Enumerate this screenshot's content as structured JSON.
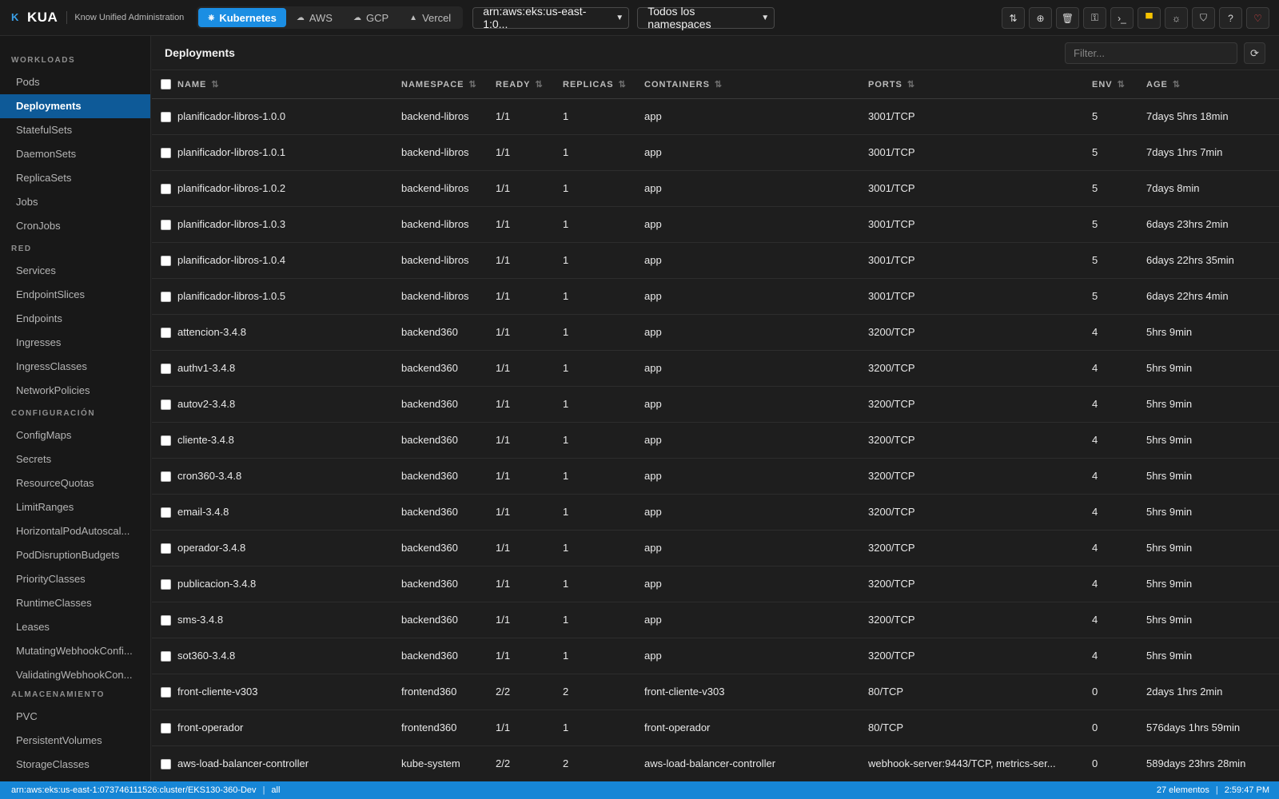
{
  "app": {
    "logo_glyph": "K",
    "name": "KUA",
    "subtitle": "Know Unified Administration"
  },
  "providers": [
    {
      "label": "Kubernetes",
      "icon": "kubernetes-icon",
      "active": true
    },
    {
      "label": "AWS",
      "icon": "cloud-icon",
      "active": false
    },
    {
      "label": "GCP",
      "icon": "cloud-icon",
      "active": false
    },
    {
      "label": "Vercel",
      "icon": "triangle-icon",
      "active": false
    }
  ],
  "cluster_select": {
    "value": "arn:aws:eks:us-east-1:0..."
  },
  "namespace_select": {
    "value": "Todos los namespaces"
  },
  "toolbar_icons": [
    "switch-icon",
    "add-circle-icon",
    "trash-icon",
    "key-icon",
    "terminal-icon",
    "spain-flag-icon",
    "sun-icon",
    "shield-icon",
    "help-icon",
    "heart-icon"
  ],
  "sidebar": {
    "sections": [
      {
        "title": "WORKLOADS",
        "items": [
          "Pods",
          "Deployments",
          "StatefulSets",
          "DaemonSets",
          "ReplicaSets",
          "Jobs",
          "CronJobs"
        ]
      },
      {
        "title": "RED",
        "items": [
          "Services",
          "EndpointSlices",
          "Endpoints",
          "Ingresses",
          "IngressClasses",
          "NetworkPolicies"
        ]
      },
      {
        "title": "CONFIGURACIÓN",
        "items": [
          "ConfigMaps",
          "Secrets",
          "ResourceQuotas",
          "LimitRanges",
          "HorizontalPodAutoscal...",
          "PodDisruptionBudgets",
          "PriorityClasses",
          "RuntimeClasses",
          "Leases",
          "MutatingWebhookConfi...",
          "ValidatingWebhookCon..."
        ]
      },
      {
        "title": "ALMACENAMIENTO",
        "items": [
          "PVC",
          "PersistentVolumes",
          "StorageClasses"
        ]
      }
    ],
    "active_item": "Deployments"
  },
  "main": {
    "title": "Deployments",
    "filter_placeholder": "Filter...",
    "columns": [
      "NAME",
      "NAMESPACE",
      "READY",
      "REPLICAS",
      "CONTAINERS",
      "PORTS",
      "ENV",
      "AGE"
    ],
    "rows": [
      [
        "planificador-libros-1.0.0",
        "backend-libros",
        "1/1",
        "1",
        "app",
        "3001/TCP",
        "5",
        "7days 5hrs 18min"
      ],
      [
        "planificador-libros-1.0.1",
        "backend-libros",
        "1/1",
        "1",
        "app",
        "3001/TCP",
        "5",
        "7days 1hrs 7min"
      ],
      [
        "planificador-libros-1.0.2",
        "backend-libros",
        "1/1",
        "1",
        "app",
        "3001/TCP",
        "5",
        "7days 8min"
      ],
      [
        "planificador-libros-1.0.3",
        "backend-libros",
        "1/1",
        "1",
        "app",
        "3001/TCP",
        "5",
        "6days 23hrs 2min"
      ],
      [
        "planificador-libros-1.0.4",
        "backend-libros",
        "1/1",
        "1",
        "app",
        "3001/TCP",
        "5",
        "6days 22hrs 35min"
      ],
      [
        "planificador-libros-1.0.5",
        "backend-libros",
        "1/1",
        "1",
        "app",
        "3001/TCP",
        "5",
        "6days 22hrs 4min"
      ],
      [
        "attencion-3.4.8",
        "backend360",
        "1/1",
        "1",
        "app",
        "3200/TCP",
        "4",
        "5hrs 9min"
      ],
      [
        "authv1-3.4.8",
        "backend360",
        "1/1",
        "1",
        "app",
        "3200/TCP",
        "4",
        "5hrs 9min"
      ],
      [
        "autov2-3.4.8",
        "backend360",
        "1/1",
        "1",
        "app",
        "3200/TCP",
        "4",
        "5hrs 9min"
      ],
      [
        "cliente-3.4.8",
        "backend360",
        "1/1",
        "1",
        "app",
        "3200/TCP",
        "4",
        "5hrs 9min"
      ],
      [
        "cron360-3.4.8",
        "backend360",
        "1/1",
        "1",
        "app",
        "3200/TCP",
        "4",
        "5hrs 9min"
      ],
      [
        "email-3.4.8",
        "backend360",
        "1/1",
        "1",
        "app",
        "3200/TCP",
        "4",
        "5hrs 9min"
      ],
      [
        "operador-3.4.8",
        "backend360",
        "1/1",
        "1",
        "app",
        "3200/TCP",
        "4",
        "5hrs 9min"
      ],
      [
        "publicacion-3.4.8",
        "backend360",
        "1/1",
        "1",
        "app",
        "3200/TCP",
        "4",
        "5hrs 9min"
      ],
      [
        "sms-3.4.8",
        "backend360",
        "1/1",
        "1",
        "app",
        "3200/TCP",
        "4",
        "5hrs 9min"
      ],
      [
        "sot360-3.4.8",
        "backend360",
        "1/1",
        "1",
        "app",
        "3200/TCP",
        "4",
        "5hrs 9min"
      ],
      [
        "front-cliente-v303",
        "frontend360",
        "2/2",
        "2",
        "front-cliente-v303",
        "80/TCP",
        "0",
        "2days 1hrs 2min"
      ],
      [
        "front-operador",
        "frontend360",
        "1/1",
        "1",
        "front-operador",
        "80/TCP",
        "0",
        "576days 1hrs 59min"
      ],
      [
        "aws-load-balancer-controller",
        "kube-system",
        "2/2",
        "2",
        "aws-load-balancer-controller",
        "webhook-server:9443/TCP, metrics-ser...",
        "0",
        "589days 23hrs 28min"
      ]
    ]
  },
  "statusbar": {
    "cluster": "arn:aws:eks:us-east-1:073746111526:cluster/EKS130-360-Dev",
    "namespace": "all",
    "count": "27 elementos",
    "time": "2:59:47 PM",
    "separator": "|"
  }
}
